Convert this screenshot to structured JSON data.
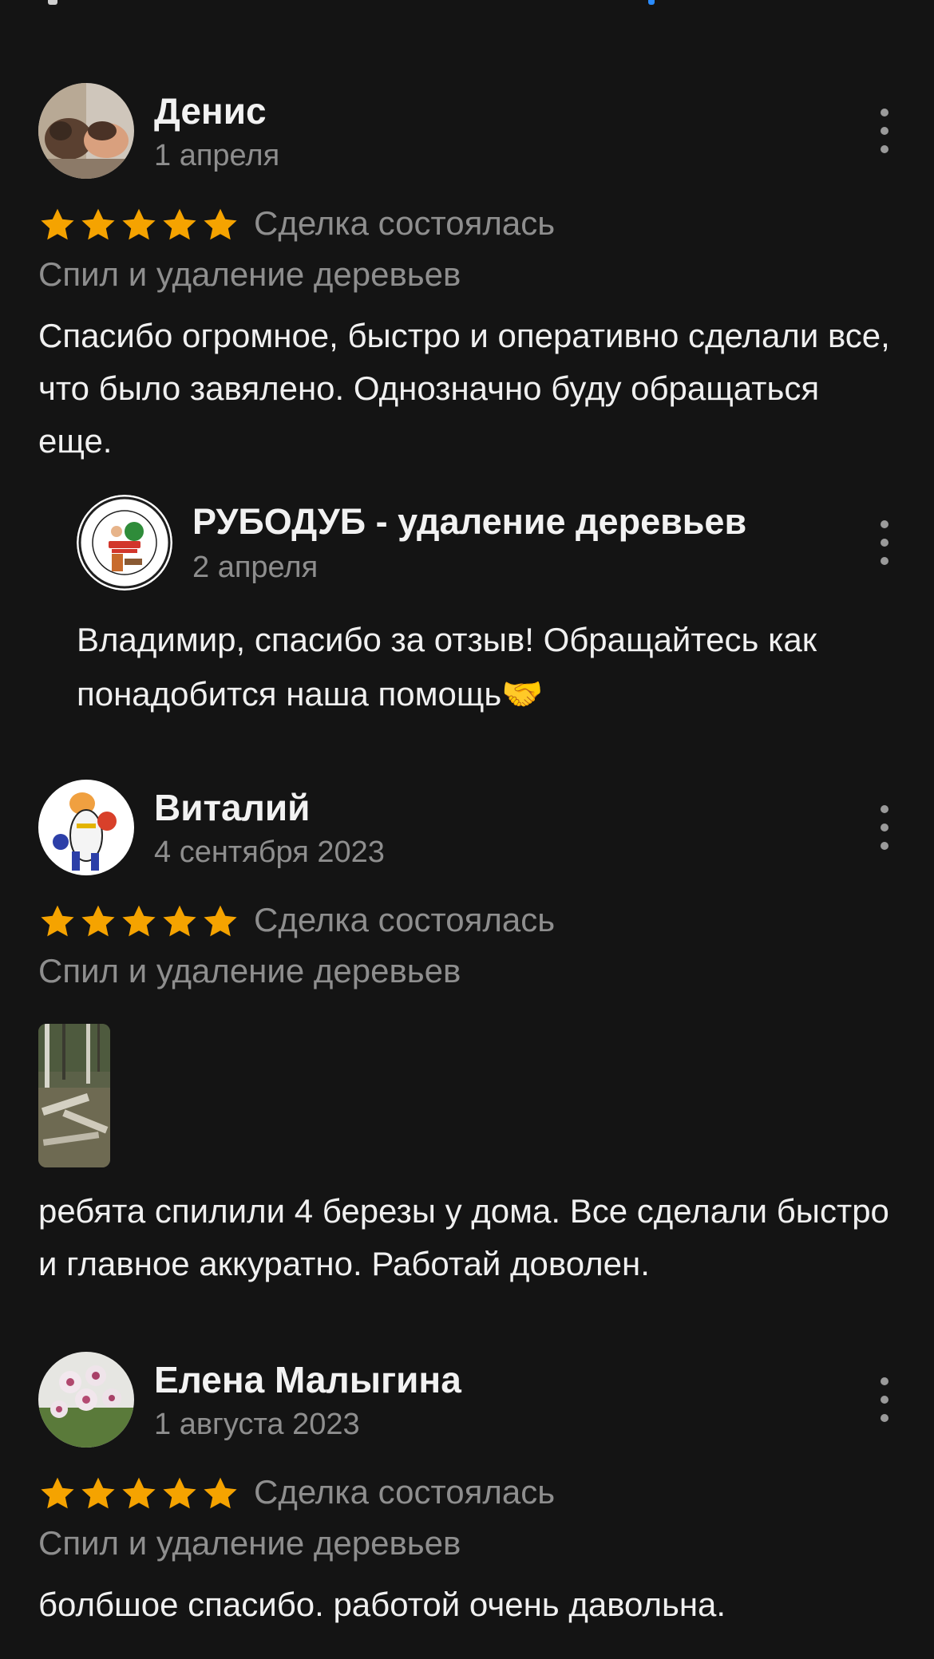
{
  "colors": {
    "background": "#141414",
    "star": "#f5a300",
    "muted_text": "#8e8e8e",
    "primary_text": "#f0f0f0",
    "link_blue": "#2a8cff"
  },
  "reviews": [
    {
      "author": "Денис",
      "date": "1 апреля",
      "rating": 5,
      "deal_status": "Сделка состоялась",
      "category": "Спил и удаление деревьев",
      "text": "Спасибо огромное, быстро и оперативно сделали все, что было завялено. Однозначно буду обращаться еще.",
      "reply": {
        "author": "РУБОДУБ - удаление деревьев",
        "date": "2 апреля",
        "text": "Владимир, спасибо за отзыв! Обращайтесь как понадобится наша помощь🤝"
      }
    },
    {
      "author": "Виталий",
      "date": "4 сентября 2023",
      "rating": 5,
      "deal_status": "Сделка состоялась",
      "category": "Спил и удаление деревьев",
      "text": "ребята спилили 4 березы у дома. Все сделали быстро и главное аккуратно. Работай доволен."
    },
    {
      "author": "Елена Малыгина",
      "date": "1 августа 2023",
      "rating": 5,
      "deal_status": "Сделка состоялась",
      "category": "Спил и удаление деревьев",
      "text": "болбшое спасибо. работой очень давольна."
    }
  ],
  "icons": {
    "more": "more-vertical-icon",
    "star": "star-icon"
  }
}
